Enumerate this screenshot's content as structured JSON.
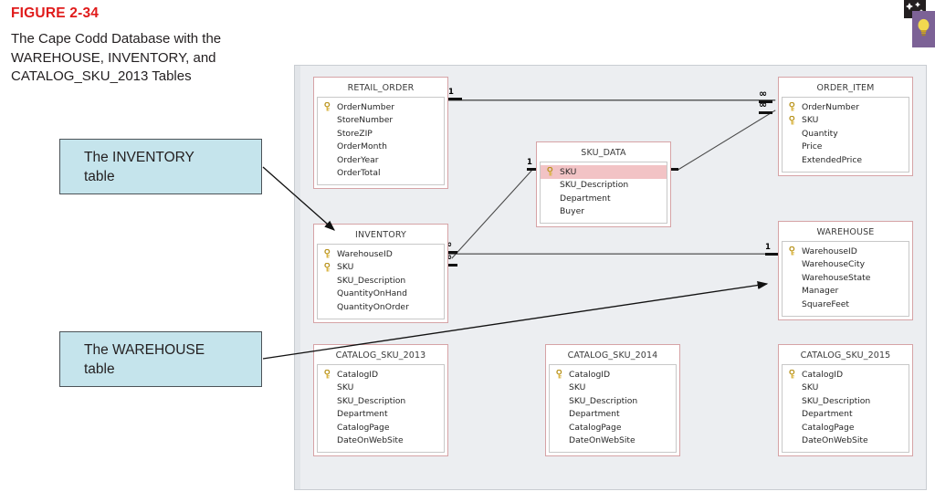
{
  "figure": {
    "number": "FIGURE 2-34",
    "title": "The Cape Codd Database with the WAREHOUSE, INVENTORY, and CATALOG_SKU_2013 Tables"
  },
  "icons": {
    "badge": "sparkle-badge-icon",
    "bulb": "lightbulb-icon"
  },
  "callouts": [
    {
      "id": "inventory",
      "line1": "The INVENTORY",
      "line2": "table"
    },
    {
      "id": "warehouse",
      "line1": "The WAREHOUSE",
      "line2": "table"
    }
  ],
  "colors": {
    "figure_number": "#e01b1b",
    "canvas_bg": "#eceef1",
    "table_border": "#d6a3a6",
    "selected_row": "#f2c3c5",
    "callout_fill": "#c5e4ec",
    "callout_border": "#4c5358",
    "bulb_tile": "#7c6296"
  },
  "tables": [
    {
      "name": "RETAIL_ORDER",
      "fields": [
        {
          "label": "OrderNumber",
          "key": true,
          "selected": false
        },
        {
          "label": "StoreNumber",
          "key": false,
          "selected": false
        },
        {
          "label": "StoreZIP",
          "key": false,
          "selected": false
        },
        {
          "label": "OrderMonth",
          "key": false,
          "selected": false
        },
        {
          "label": "OrderYear",
          "key": false,
          "selected": false
        },
        {
          "label": "OrderTotal",
          "key": false,
          "selected": false
        }
      ]
    },
    {
      "name": "ORDER_ITEM",
      "fields": [
        {
          "label": "OrderNumber",
          "key": true,
          "selected": false
        },
        {
          "label": "SKU",
          "key": true,
          "selected": false
        },
        {
          "label": "Quantity",
          "key": false,
          "selected": false
        },
        {
          "label": "Price",
          "key": false,
          "selected": false
        },
        {
          "label": "ExtendedPrice",
          "key": false,
          "selected": false
        }
      ]
    },
    {
      "name": "SKU_DATA",
      "fields": [
        {
          "label": "SKU",
          "key": true,
          "selected": true
        },
        {
          "label": "SKU_Description",
          "key": false,
          "selected": false
        },
        {
          "label": "Department",
          "key": false,
          "selected": false
        },
        {
          "label": "Buyer",
          "key": false,
          "selected": false
        }
      ]
    },
    {
      "name": "INVENTORY",
      "fields": [
        {
          "label": "WarehouseID",
          "key": true,
          "selected": false
        },
        {
          "label": "SKU",
          "key": true,
          "selected": false
        },
        {
          "label": "SKU_Description",
          "key": false,
          "selected": false
        },
        {
          "label": "QuantityOnHand",
          "key": false,
          "selected": false
        },
        {
          "label": "QuantityOnOrder",
          "key": false,
          "selected": false
        }
      ]
    },
    {
      "name": "WAREHOUSE",
      "fields": [
        {
          "label": "WarehouseID",
          "key": true,
          "selected": false
        },
        {
          "label": "WarehouseCity",
          "key": false,
          "selected": false
        },
        {
          "label": "WarehouseState",
          "key": false,
          "selected": false
        },
        {
          "label": "Manager",
          "key": false,
          "selected": false
        },
        {
          "label": "SquareFeet",
          "key": false,
          "selected": false
        }
      ]
    },
    {
      "name": "CATALOG_SKU_2013",
      "fields": [
        {
          "label": "CatalogID",
          "key": true,
          "selected": false
        },
        {
          "label": "SKU",
          "key": false,
          "selected": false
        },
        {
          "label": "SKU_Description",
          "key": false,
          "selected": false
        },
        {
          "label": "Department",
          "key": false,
          "selected": false
        },
        {
          "label": "CatalogPage",
          "key": false,
          "selected": false
        },
        {
          "label": "DateOnWebSite",
          "key": false,
          "selected": false
        }
      ]
    },
    {
      "name": "CATALOG_SKU_2014",
      "fields": [
        {
          "label": "CatalogID",
          "key": true,
          "selected": false
        },
        {
          "label": "SKU",
          "key": false,
          "selected": false
        },
        {
          "label": "SKU_Description",
          "key": false,
          "selected": false
        },
        {
          "label": "Department",
          "key": false,
          "selected": false
        },
        {
          "label": "CatalogPage",
          "key": false,
          "selected": false
        },
        {
          "label": "DateOnWebSite",
          "key": false,
          "selected": false
        }
      ]
    },
    {
      "name": "CATALOG_SKU_2015",
      "fields": [
        {
          "label": "CatalogID",
          "key": true,
          "selected": false
        },
        {
          "label": "SKU",
          "key": false,
          "selected": false
        },
        {
          "label": "SKU_Description",
          "key": false,
          "selected": false
        },
        {
          "label": "Department",
          "key": false,
          "selected": false
        },
        {
          "label": "CatalogPage",
          "key": false,
          "selected": false
        },
        {
          "label": "DateOnWebSite",
          "key": false,
          "selected": false
        }
      ]
    }
  ],
  "relationships": [
    {
      "from": "RETAIL_ORDER",
      "from_card": "1",
      "to": "ORDER_ITEM",
      "to_card": "∞"
    },
    {
      "from": "SKU_DATA",
      "from_card": "1",
      "to": "ORDER_ITEM",
      "to_card": "∞"
    },
    {
      "from": "SKU_DATA",
      "from_card": "1",
      "to": "INVENTORY",
      "to_card": "∞"
    },
    {
      "from": "WAREHOUSE",
      "from_card": "1",
      "to": "INVENTORY",
      "to_card": "∞"
    }
  ],
  "cardinality_markers": {
    "one": "1",
    "many": "∞"
  }
}
